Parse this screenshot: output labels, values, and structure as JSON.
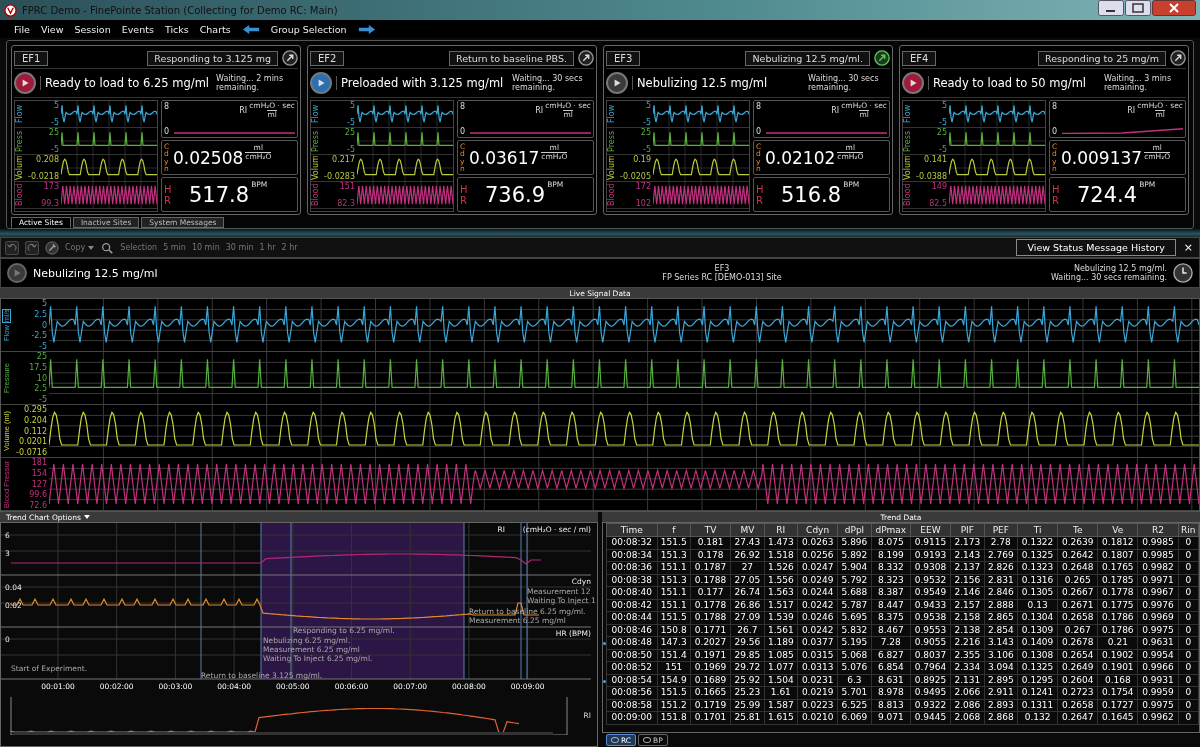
{
  "window": {
    "title": "FPRC Demo - FinePointe Station (Collecting for Demo RC: Main)"
  },
  "menu": [
    "File",
    "View",
    "Session",
    "Events",
    "Ticks",
    "Charts"
  ],
  "group_selection": "Group Selection",
  "sites": [
    {
      "name": "EF1",
      "status": "Responding to 3.125 mg",
      "status_ok": false,
      "color": "#a0183a",
      "message": "Ready to load to 6.25 mg/ml",
      "waiting": "Waiting... 2 mins remaining.",
      "traces": [
        {
          "kind": "flow",
          "label": "Flow",
          "color": "#3aa7d8",
          "ticks": [
            "5",
            "-5"
          ]
        },
        {
          "kind": "pressure",
          "label": "Press",
          "color": "#55b03c",
          "ticks": [
            "25",
            "-5"
          ]
        },
        {
          "kind": "volume",
          "label": "Volum",
          "color": "#b9c93a",
          "ticks": [
            "0.208",
            "-0.0218"
          ]
        },
        {
          "kind": "bp",
          "label": "Blood",
          "color": "#c2307f",
          "ticks": [
            "173",
            "99.3"
          ]
        }
      ],
      "ri": {
        "label": "RI",
        "unit_top": "cmH₂O · sec",
        "unit_bottom": "ml",
        "ticks": [
          "8",
          "0"
        ]
      },
      "cdyn": {
        "label": "Cdyn",
        "value": "0.02508",
        "unit_top": "ml",
        "unit_bottom": "cmH₂O"
      },
      "hr": {
        "label": "HR",
        "value": "517.8",
        "unit": "BPM"
      }
    },
    {
      "name": "EF2",
      "status": "Return to baseline PBS.",
      "status_ok": false,
      "color": "#2a6fb0",
      "message": "Preloaded with 3.125 mg/ml",
      "waiting": "Waiting... 30 secs remaining.",
      "traces": [
        {
          "kind": "flow",
          "label": "Flow",
          "color": "#3aa7d8",
          "ticks": [
            "5",
            "-5"
          ]
        },
        {
          "kind": "pressure",
          "label": "Press",
          "color": "#55b03c",
          "ticks": [
            "25",
            "-5"
          ]
        },
        {
          "kind": "volume",
          "label": "Volum",
          "color": "#b9c93a",
          "ticks": [
            "0.217",
            "-0.0283"
          ]
        },
        {
          "kind": "bp",
          "label": "Blood",
          "color": "#c2307f",
          "ticks": [
            "151",
            "82.3"
          ]
        }
      ],
      "ri": {
        "label": "RI",
        "unit_top": "cmH₂O · sec",
        "unit_bottom": "ml",
        "ticks": [
          "8",
          "0"
        ]
      },
      "cdyn": {
        "label": "Cdyn",
        "value": "0.03617",
        "unit_top": "ml",
        "unit_bottom": "cmH₂O"
      },
      "hr": {
        "label": "HR",
        "value": "736.9",
        "unit": "BPM"
      }
    },
    {
      "name": "EF3",
      "status": "Nebulizing 12.5 mg/ml.",
      "status_ok": true,
      "color": "#3a3a3a",
      "message": "Nebulizing 12.5 mg/ml",
      "waiting": "Waiting... 30 secs remaining.",
      "traces": [
        {
          "kind": "flow",
          "label": "Flow",
          "color": "#3aa7d8",
          "ticks": [
            "5",
            "-5"
          ]
        },
        {
          "kind": "pressure",
          "label": "Press",
          "color": "#55b03c",
          "ticks": [
            "25",
            "-5"
          ]
        },
        {
          "kind": "volume",
          "label": "Volum",
          "color": "#b9c93a",
          "ticks": [
            "0.19",
            "-0.0205"
          ]
        },
        {
          "kind": "bp",
          "label": "Blood",
          "color": "#c2307f",
          "ticks": [
            "172",
            "102"
          ]
        }
      ],
      "ri": {
        "label": "RI",
        "unit_top": "cmH₂O · sec",
        "unit_bottom": "ml",
        "ticks": [
          "8",
          "0"
        ]
      },
      "cdyn": {
        "label": "Cdyn",
        "value": "0.02102",
        "unit_top": "ml",
        "unit_bottom": "cmH₂O"
      },
      "hr": {
        "label": "HR",
        "value": "516.8",
        "unit": "BPM"
      }
    },
    {
      "name": "EF4",
      "status": "Responding to 25 mg/m",
      "status_ok": false,
      "color": "#a0183a",
      "message": "Ready to load to 50 mg/ml",
      "waiting": "Waiting... 3 mins remaining.",
      "traces": [
        {
          "kind": "flow",
          "label": "Flow",
          "color": "#3aa7d8",
          "ticks": [
            "5",
            "-5"
          ]
        },
        {
          "kind": "pressure",
          "label": "Press",
          "color": "#55b03c",
          "ticks": [
            "25",
            "-5"
          ]
        },
        {
          "kind": "volume",
          "label": "Volum",
          "color": "#b9c93a",
          "ticks": [
            "0.141",
            "-0.0388"
          ]
        },
        {
          "kind": "bp",
          "label": "Blood",
          "color": "#c2307f",
          "ticks": [
            "149",
            "82.5"
          ]
        }
      ],
      "ri": {
        "label": "RI",
        "unit_top": "cmH₂O · sec",
        "unit_bottom": "ml",
        "ticks": [
          "8",
          "0"
        ]
      },
      "cdyn": {
        "label": "Cdyn",
        "value": "0.009137",
        "unit_top": "ml",
        "unit_bottom": "cmH₂O"
      },
      "hr": {
        "label": "HR",
        "value": "724.4",
        "unit": "BPM"
      }
    }
  ],
  "site_tabs": [
    {
      "label": "Active Sites",
      "selected": true
    },
    {
      "label": "Inactive Sites",
      "selected": false
    },
    {
      "label": "System Messages",
      "selected": false
    }
  ],
  "toolbar": {
    "copy": "Copy",
    "selection": "Selection",
    "ranges": [
      "5 min",
      "10 min",
      "30 min",
      "1 hr",
      "2 hr"
    ],
    "history_button": "View Status Message History",
    "close": "×"
  },
  "detail": {
    "color": "#3a3a3a",
    "message": "Nebulizing 12.5 mg/ml",
    "site": "EF3",
    "series": "FP Series RC [DEMO-013] Site",
    "status": "Nebulizing 12.5 mg/ml.",
    "waiting": "Waiting... 30 secs remaining."
  },
  "live": {
    "title": "Live Signal Data",
    "rows": [
      {
        "kind": "flow",
        "label": "Flow",
        "unit": "ml/s",
        "color": "#3aa7d8",
        "ticks": [
          "5",
          "2.5",
          "0",
          "-2.5",
          "-5"
        ]
      },
      {
        "kind": "pressure",
        "label": "Pressure",
        "color": "#55b03c",
        "ticks": [
          "25",
          "17.5",
          "10",
          "2.5",
          "-5"
        ]
      },
      {
        "kind": "volume",
        "label": "Volume (ml)",
        "color": "#c9d43a",
        "ticks": [
          "0.295",
          "0.204",
          "0.112",
          "0.0201",
          "-0.0716"
        ]
      },
      {
        "kind": "bp",
        "label": "Blood Pressur",
        "color": "#c2307f",
        "ticks": [
          "181",
          "154",
          "127",
          "99.6",
          "72.6"
        ]
      }
    ]
  },
  "trend_chart": {
    "options": "Trend Chart Options",
    "panels": [
      {
        "label": "RI",
        "unit": "(cmH₂O · sec / ml)",
        "ticks": [
          "6",
          "3"
        ]
      },
      {
        "label": "Cdyn",
        "ticks": [
          "0.04",
          "0.02"
        ]
      },
      {
        "label": "HR (BPM)",
        "ticks": [
          "0"
        ]
      }
    ],
    "xticks": [
      "00:01:00",
      "00:02:00",
      "00:03:00",
      "00:04:00",
      "00:05:00",
      "00:06:00",
      "00:07:00",
      "00:08:00",
      "00:09:00"
    ],
    "annotations": [
      "Start of Experiment.",
      "Return to baseline 3.125 mg/ml.",
      "Nebulizing 6.25 mg/ml.",
      "Measurement 6.25 mg/ml",
      "Waiting To Inject 6.25 mg/ml.",
      "Responding to 6.25 mg/ml.",
      "Return to baseline 6.25 mg/ml.",
      "Measurement 6.25 mg/ml",
      "Measurement 12",
      "Waiting To Inject 1"
    ],
    "overview_label": "RI"
  },
  "trend_data": {
    "title": "Trend Data",
    "columns": [
      "Time",
      "f",
      "TV",
      "MV",
      "RI",
      "Cdyn",
      "dPpl",
      "dPmax",
      "EEW",
      "PIF",
      "PEF",
      "Ti",
      "Te",
      "Ve",
      "R2",
      "Rin"
    ],
    "rows": [
      {
        "marked": false,
        "cells": [
          "00:08:32",
          "151.5",
          "0.181",
          "27.43",
          "1.473",
          "0.0263",
          "5.896",
          "8.075",
          "0.9115",
          "2.173",
          "2.78",
          "0.1322",
          "0.2639",
          "0.1812",
          "0.9985",
          "0"
        ]
      },
      {
        "marked": false,
        "cells": [
          "00:08:34",
          "151.3",
          "0.178",
          "26.92",
          "1.518",
          "0.0256",
          "5.892",
          "8.199",
          "0.9193",
          "2.143",
          "2.769",
          "0.1325",
          "0.2642",
          "0.1807",
          "0.9985",
          "0"
        ]
      },
      {
        "marked": false,
        "cells": [
          "00:08:36",
          "151.1",
          "0.1787",
          "27",
          "1.526",
          "0.0247",
          "5.904",
          "8.332",
          "0.9308",
          "2.137",
          "2.826",
          "0.1323",
          "0.2648",
          "0.1765",
          "0.9982",
          "0"
        ]
      },
      {
        "marked": false,
        "cells": [
          "00:08:38",
          "151.3",
          "0.1788",
          "27.05",
          "1.556",
          "0.0249",
          "5.792",
          "8.323",
          "0.9532",
          "2.156",
          "2.831",
          "0.1316",
          "0.265",
          "0.1785",
          "0.9971",
          "0"
        ]
      },
      {
        "marked": false,
        "cells": [
          "00:08:40",
          "151.1",
          "0.177",
          "26.74",
          "1.563",
          "0.0244",
          "5.688",
          "8.387",
          "0.9549",
          "2.146",
          "2.846",
          "0.1305",
          "0.2667",
          "0.1778",
          "0.9967",
          "0"
        ]
      },
      {
        "marked": false,
        "cells": [
          "00:08:42",
          "151.1",
          "0.1778",
          "26.86",
          "1.517",
          "0.0242",
          "5.787",
          "8.447",
          "0.9433",
          "2.157",
          "2.888",
          "0.13",
          "0.2671",
          "0.1775",
          "0.9976",
          "0"
        ]
      },
      {
        "marked": false,
        "cells": [
          "00:08:44",
          "151.5",
          "0.1788",
          "27.09",
          "1.539",
          "0.0246",
          "5.695",
          "8.375",
          "0.9538",
          "2.158",
          "2.865",
          "0.1304",
          "0.2658",
          "0.1786",
          "0.9969",
          "0"
        ]
      },
      {
        "marked": false,
        "cells": [
          "00:08:46",
          "150.8",
          "0.1771",
          "26.7",
          "1.561",
          "0.0242",
          "5.832",
          "8.467",
          "0.9553",
          "2.138",
          "2.854",
          "0.1309",
          "0.267",
          "0.1786",
          "0.9975",
          "0"
        ]
      },
      {
        "marked": true,
        "cells": [
          "00:08:48",
          "147.3",
          "0.2027",
          "29.56",
          "1.189",
          "0.0377",
          "5.195",
          "7.28",
          "0.9055",
          "2.216",
          "3.143",
          "0.1409",
          "0.2678",
          "0.21",
          "0.9631",
          "0"
        ]
      },
      {
        "marked": false,
        "cells": [
          "00:08:50",
          "151.4",
          "0.1971",
          "29.85",
          "1.085",
          "0.0315",
          "5.068",
          "6.827",
          "0.8037",
          "2.355",
          "3.106",
          "0.1308",
          "0.2654",
          "0.1902",
          "0.9954",
          "0"
        ]
      },
      {
        "marked": false,
        "cells": [
          "00:08:52",
          "151",
          "0.1969",
          "29.72",
          "1.077",
          "0.0313",
          "5.076",
          "6.854",
          "0.7964",
          "2.334",
          "3.094",
          "0.1325",
          "0.2649",
          "0.1901",
          "0.9966",
          "0"
        ]
      },
      {
        "marked": true,
        "cells": [
          "00:08:54",
          "154.9",
          "0.1689",
          "25.92",
          "1.504",
          "0.0231",
          "6.3",
          "8.631",
          "0.8925",
          "2.131",
          "2.895",
          "0.1295",
          "0.2604",
          "0.168",
          "0.9931",
          "0"
        ]
      },
      {
        "marked": false,
        "cells": [
          "00:08:56",
          "151.5",
          "0.1665",
          "25.23",
          "1.61",
          "0.0219",
          "5.701",
          "8.978",
          "0.9495",
          "2.066",
          "2.911",
          "0.1241",
          "0.2723",
          "0.1754",
          "0.9959",
          "0"
        ]
      },
      {
        "marked": false,
        "cells": [
          "00:08:58",
          "151.2",
          "0.1719",
          "25.99",
          "1.587",
          "0.0223",
          "6.525",
          "8.813",
          "0.9322",
          "2.086",
          "2.893",
          "0.1311",
          "0.2658",
          "0.1727",
          "0.9975",
          "0"
        ]
      },
      {
        "marked": false,
        "cells": [
          "00:09:00",
          "151.8",
          "0.1701",
          "25.81",
          "1.615",
          "0.0210",
          "6.069",
          "9.071",
          "0.9445",
          "2.068",
          "2.868",
          "0.132",
          "0.2647",
          "0.1645",
          "0.9962",
          "0"
        ]
      }
    ]
  },
  "data_tabs": [
    {
      "label": "RC",
      "selected": true
    },
    {
      "label": "BP",
      "selected": false
    }
  ]
}
